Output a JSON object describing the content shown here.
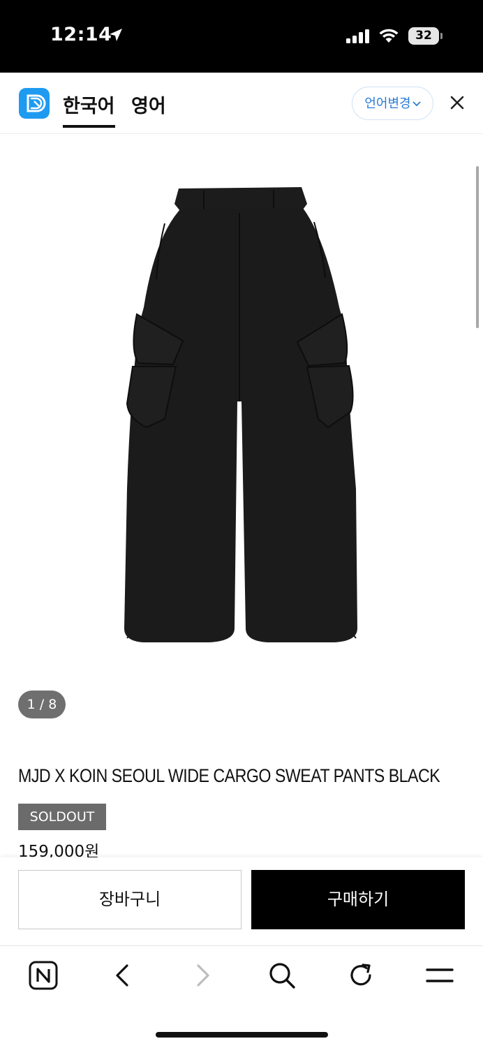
{
  "status_bar": {
    "time": "12:14",
    "battery": "32"
  },
  "translate_bar": {
    "tab_korean": "한국어",
    "tab_english": "영어",
    "lang_change": "언어변경"
  },
  "product": {
    "image_counter": "1 / 8",
    "title": "MJD X KOIN SEOUL WIDE CARGO SWEAT PANTS BLACK",
    "badge": "SOLDOUT",
    "price": "159,000원"
  },
  "actions": {
    "cart_label": "장바구니",
    "buy_label": "구매하기"
  },
  "icons": {
    "logo": "translate-app-icon",
    "close": "close-icon",
    "toolbar": [
      "naver-home-icon",
      "back-icon",
      "forward-icon",
      "search-icon",
      "refresh-icon",
      "menu-icon"
    ]
  },
  "colors": {
    "accent_blue": "#1e9bf0",
    "buy_button": "#000000",
    "badge": "#6b6b6b"
  }
}
